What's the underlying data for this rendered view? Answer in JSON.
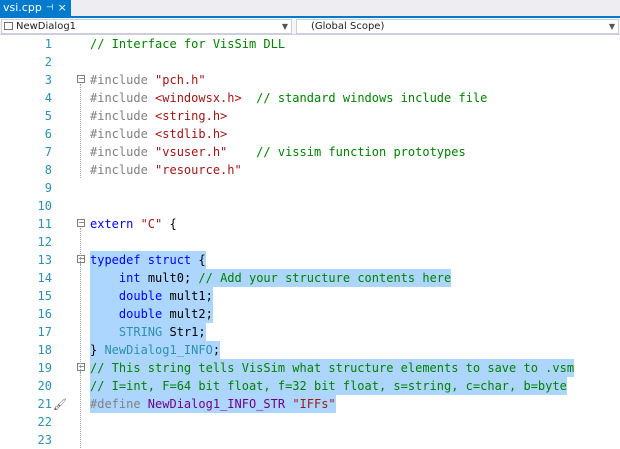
{
  "tab": {
    "title": "vsi.cpp",
    "pin_glyph": "⊣",
    "close_glyph": "×"
  },
  "nav": {
    "left_dropdown": "NewDialog1",
    "right_dropdown": "(Global Scope)"
  },
  "lines": [
    {
      "num": "1",
      "segments": [
        {
          "t": "// Interface for VisSim DLL",
          "c": "c"
        }
      ]
    },
    {
      "num": "2",
      "segments": []
    },
    {
      "num": "3",
      "fold": "⊟",
      "segments": [
        {
          "t": "#include ",
          "c": "p"
        },
        {
          "t": "\"pch.h\"",
          "c": "s"
        }
      ]
    },
    {
      "num": "4",
      "segments": [
        {
          "t": "#include ",
          "c": "p"
        },
        {
          "t": "<windowsx.h>",
          "c": "s"
        },
        {
          "t": "  // standard windows include file",
          "c": "c"
        }
      ]
    },
    {
      "num": "5",
      "segments": [
        {
          "t": "#include ",
          "c": "p"
        },
        {
          "t": "<string.h>",
          "c": "s"
        }
      ]
    },
    {
      "num": "6",
      "segments": [
        {
          "t": "#include ",
          "c": "p"
        },
        {
          "t": "<stdlib.h>",
          "c": "s"
        }
      ]
    },
    {
      "num": "7",
      "segments": [
        {
          "t": "#include ",
          "c": "p"
        },
        {
          "t": "\"vsuser.h\"",
          "c": "s"
        },
        {
          "t": "    // vissim function prototypes",
          "c": "c"
        }
      ]
    },
    {
      "num": "8",
      "segments": [
        {
          "t": "#include ",
          "c": "p"
        },
        {
          "t": "\"resource.h\"",
          "c": "s"
        }
      ]
    },
    {
      "num": "9",
      "segments": []
    },
    {
      "num": "10",
      "segments": []
    },
    {
      "num": "11",
      "fold": "⊟",
      "segments": [
        {
          "t": "extern ",
          "c": "k"
        },
        {
          "t": "\"C\"",
          "c": "s"
        },
        {
          "t": " {",
          "c": "n"
        }
      ]
    },
    {
      "num": "12",
      "segments": []
    },
    {
      "num": "13",
      "fold": "⊟",
      "hl": true,
      "segments": [
        {
          "t": "typedef ",
          "c": "k"
        },
        {
          "t": "struct",
          "c": "k"
        },
        {
          "t": " {",
          "c": "n"
        }
      ]
    },
    {
      "num": "14",
      "hl": true,
      "segments": [
        {
          "t": "    ",
          "c": "n"
        },
        {
          "t": "int",
          "c": "k"
        },
        {
          "t": " mult0; ",
          "c": "n"
        },
        {
          "t": "// Add your structure contents here",
          "c": "c"
        }
      ]
    },
    {
      "num": "15",
      "hl": true,
      "segments": [
        {
          "t": "    ",
          "c": "n"
        },
        {
          "t": "double",
          "c": "k"
        },
        {
          "t": " mult1;",
          "c": "n"
        }
      ]
    },
    {
      "num": "16",
      "hl": true,
      "segments": [
        {
          "t": "    ",
          "c": "n"
        },
        {
          "t": "double",
          "c": "k"
        },
        {
          "t": " mult2;",
          "c": "n"
        }
      ]
    },
    {
      "num": "17",
      "hl": true,
      "segments": [
        {
          "t": "    ",
          "c": "n"
        },
        {
          "t": "STRING",
          "c": "t"
        },
        {
          "t": " Str1;",
          "c": "n"
        }
      ]
    },
    {
      "num": "18",
      "hl": true,
      "segments": [
        {
          "t": "} ",
          "c": "n"
        },
        {
          "t": "NewDialog1_INFO",
          "c": "t"
        },
        {
          "t": ";",
          "c": "n"
        }
      ]
    },
    {
      "num": "19",
      "fold": "⊟",
      "hl": true,
      "segments": [
        {
          "t": "// This string tells VisSim what structure elements to save to .vsm",
          "c": "c"
        }
      ]
    },
    {
      "num": "20",
      "hl": true,
      "segments": [
        {
          "t": "// I=int, F=64 bit float, f=32 bit float, s=string, c=char, b=byte",
          "c": "c"
        }
      ]
    },
    {
      "num": "21",
      "hl": true,
      "brush": "🖌",
      "segments": [
        {
          "t": "#define ",
          "c": "p"
        },
        {
          "t": "NewDialog1_INFO_STR",
          "c": "m"
        },
        {
          "t": " ",
          "c": "n"
        },
        {
          "t": "\"IFFs\"",
          "c": "s"
        }
      ]
    },
    {
      "num": "22",
      "segments": []
    },
    {
      "num": "23",
      "segments": []
    }
  ]
}
